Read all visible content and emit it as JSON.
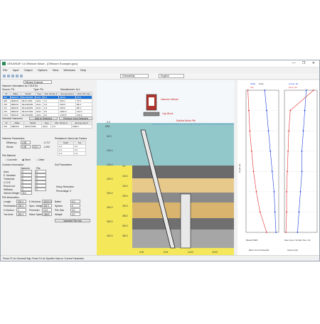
{
  "window": {
    "title": "GRLWEAP 14 Offshore Wave - [Offshore Example.gwo]",
    "controls": "— ❐ ✕"
  },
  "menu": [
    "File",
    "Input",
    "Output",
    "Options",
    "View",
    "Windows",
    "Help"
  ],
  "toolbar": {
    "analysis_mode": "Driveability",
    "units": "English"
  },
  "hammer": {
    "pile_label": "Offshore Example",
    "section_title": "Hammer Information for TODTS4",
    "source_label": "Source: PIL",
    "type_label": "Type: PIL",
    "manufacturer_label": "Manufacturer: ALL",
    "columns": [
      "ID",
      "Make",
      "Model",
      "Type",
      "Rtd. Stroke ft",
      "Energy kips-ft",
      "Ram Wt. kips"
    ],
    "rows": [
      [
        "300",
        "MENCK",
        "MHU1000S",
        "ECH",
        "5.4",
        "660.0",
        "79.5"
      ],
      [
        "463",
        "MENCK",
        "MHU 1000",
        "ECH",
        "1.0",
        "660.1",
        "79.5"
      ],
      [
        "470",
        "MENCK",
        "MHU1000S",
        "ECH",
        "1.8",
        "660.0",
        "88.4"
      ],
      [
        "471",
        "MENCK",
        "MHU1000S",
        "ECH",
        "1.8",
        "660.0",
        "88.4"
      ],
      [
        "479",
        "MENCK",
        "MHU1700S",
        "ECH",
        "0.0",
        "1180.0",
        "112.0"
      ],
      [
        "1417",
        "MENCK",
        "MHU1900S",
        "ECH",
        "0.0",
        "1376.5",
        "126.9"
      ]
    ],
    "selected_title": "Selected Hammers",
    "add_button": "Add to Selected Hammers",
    "remove_button": "Remove from Selected Hammers",
    "selected_columns": [
      "ID",
      "Make",
      "Model",
      "Type",
      "Rtd. Stroke ft",
      "Energy kips-ft"
    ],
    "selected_rows": [
      [
        "479",
        "MENCK",
        "MHU1700S",
        "ECH",
        "0.0",
        "1180.0"
      ]
    ]
  },
  "hammer_params": {
    "title": "Hammer Parameters",
    "efficiency_label": "Efficiency",
    "efficiency": "0.95",
    "stroke_label": "Stroke",
    "stroke": "5.98",
    "stroke_unit": "ECH",
    "energy_note": "-0.717",
    "helmet_note": "-2.5%"
  },
  "resistance": {
    "title": "Resistance Gain/Loss Factors",
    "columns": [
      "Shaft",
      "Toe"
    ],
    "rows": [
      [
        "1.0",
        "1.0"
      ],
      [
        "1.0",
        "1.0"
      ],
      [
        "1.0",
        "1.0"
      ]
    ]
  },
  "pile_material": {
    "title": "Pile Material",
    "concrete": "Concrete",
    "steel": "Steel",
    "timber": "Other"
  },
  "cushion": {
    "title": "Cushion Information",
    "columns": [
      "Hammer",
      "Pile"
    ],
    "rows": [
      {
        "label": "Area",
        "h": "0",
        "p": "0"
      },
      {
        "label": "E. Modulus",
        "h": "0",
        "p": "0"
      },
      {
        "label": "Thickness",
        "h": "0",
        "p": "0"
      },
      {
        "label": "C.O.R.",
        "h": "0",
        "p": "0"
      },
      {
        "label": "Round-out",
        "h": "0",
        "p": "0"
      },
      {
        "label": "Stiffness",
        "h": "0",
        "p": "0"
      },
      {
        "label": "Helmet Weight",
        "h": "39.2",
        "p": ""
      }
    ]
  },
  "soil": {
    "title": "Soil Parameters",
    "setup": "Setup Reduction",
    "percentage": "Percentage: 0"
  },
  "pile_info": {
    "title": "Pile Information",
    "length_label": "Length",
    "length": "300.0",
    "penetration_label": "Penetration",
    "penetration": "230.0",
    "x_section_label": "X-Section",
    "x_section": "1",
    "toe_area_label": "Toe Area",
    "toe_area": "452.4",
    "e_modulus_label": "E-Modulus",
    "e_modulus": "30000.0",
    "spec_weight_label": "Spec. Weight",
    "spec_weight": "492.0",
    "perimeter_label": "Perimeter",
    "perimeter": "10.3",
    "wave_speed_label": "Wave Speed",
    "wave_speed": "16800",
    "uniform_label": "Uniform",
    "batter_label": "Batter",
    "batter": "0.0",
    "splices_label": "Splices",
    "splices": "0",
    "pile_size_label": "Pile Size",
    "pile_size": "0.0",
    "weight_label": "Weight",
    "weight": "0.0"
  },
  "pile_sections": {
    "title": "Variable Pile Information",
    "button": "Variable Pile Info"
  },
  "canvas": {
    "sea_label": "MSL",
    "hammer_label": "Hammer Helmet",
    "cap_label": "Cap Block",
    "ground_label": "Mudline Below Pile",
    "depth_labels": [
      "0.0",
      "50.0",
      "100.0",
      "150.0",
      "200.0",
      "250.0",
      "300.0",
      "350.0",
      "400.0"
    ],
    "right_labels": [
      "0.0",
      "100.0",
      "150.0",
      "200.0",
      "240.0",
      "280.0",
      "300.0",
      "360.0"
    ],
    "bottom_labels": [
      "0.00",
      "5.00",
      "10.00",
      "15.00"
    ]
  },
  "chart_left": {
    "legend": [
      "Shaft",
      "Total",
      "Toe"
    ],
    "xlabel": "Blow Count (blows/ft)",
    "ylabel": "Depth (ft)",
    "bottom": "Blows/ft   SRD"
  },
  "chart_right": {
    "legend": [
      "Comp. Str",
      "Tens. Str"
    ],
    "xlabel": "Stress (ksi)",
    "bottom": "Max Comp. Str   Max Tens. Str"
  },
  "chart_data": [
    {
      "type": "line",
      "xlabel": "Blow Count (blows/ft)",
      "ylabel": "Depth (ft)",
      "series": [
        {
          "name": "Shaft",
          "color": "#1a3fd8",
          "x": [
            20,
            22,
            24,
            26,
            28,
            30,
            31,
            32
          ],
          "y": [
            0,
            50,
            100,
            150,
            200,
            250,
            300,
            350
          ]
        },
        {
          "name": "Toe",
          "color": "#e23030",
          "x": [
            2,
            3,
            4,
            6,
            8,
            11,
            15,
            22
          ],
          "y": [
            0,
            50,
            100,
            150,
            200,
            250,
            300,
            350
          ]
        }
      ]
    },
    {
      "type": "line",
      "xlabel": "Stress (ksi)",
      "series": [
        {
          "name": "Comp. Str",
          "color": "#1a3fd8",
          "x": [
            30,
            28,
            26,
            24,
            24,
            22,
            20,
            18
          ],
          "y": [
            0,
            50,
            100,
            150,
            200,
            250,
            300,
            350
          ]
        },
        {
          "name": "Tens. Str",
          "color": "#e23030",
          "x": [
            40,
            8,
            6,
            5,
            4,
            3,
            3,
            2
          ],
          "y": [
            0,
            50,
            100,
            150,
            200,
            250,
            300,
            350
          ]
        }
      ]
    }
  ],
  "status": "Press F1 for General Help; Press Fn for Specific Help on Current Parameter",
  "colors": {
    "sky": "#e6f0f6",
    "sea": "#4fa8a8",
    "soil_light": "#e8c98c",
    "soil_dark": "#555555",
    "blue": "#1a3fd8",
    "red": "#e23030",
    "yellow": "#f4e85a"
  }
}
